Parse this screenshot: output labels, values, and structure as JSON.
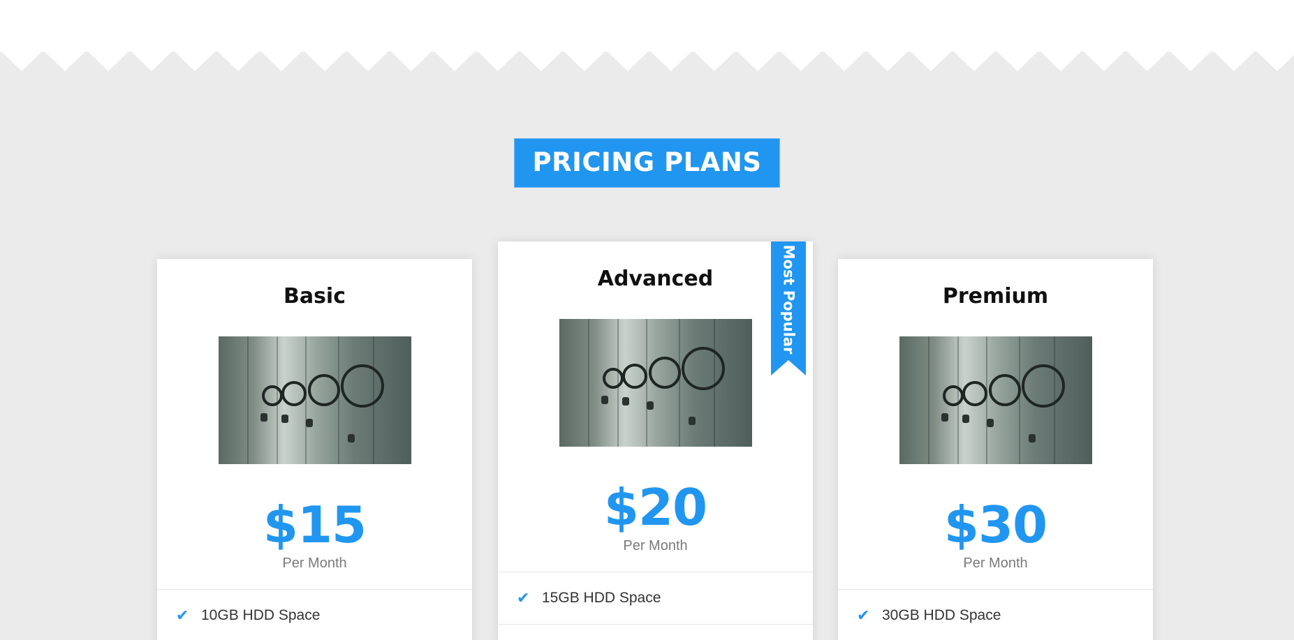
{
  "section": {
    "title": "PRICING PLANS"
  },
  "colors": {
    "accent": "#2196f0",
    "background": "#ebebeb",
    "card": "#ffffff"
  },
  "plans": [
    {
      "name": "Basic",
      "price": "$15",
      "period": "Per Month",
      "image_icon": "vault-doors-image",
      "features": [
        "10GB HDD Space"
      ]
    },
    {
      "name": "Advanced",
      "price": "$20",
      "period": "Per Month",
      "image_icon": "vault-doors-image",
      "ribbon": "Most Popular",
      "features": [
        "15GB HDD Space"
      ]
    },
    {
      "name": "Premium",
      "price": "$30",
      "period": "Per Month",
      "image_icon": "vault-doors-image",
      "features": [
        "30GB HDD Space"
      ]
    }
  ],
  "icons": {
    "feature_check": "check-icon"
  }
}
